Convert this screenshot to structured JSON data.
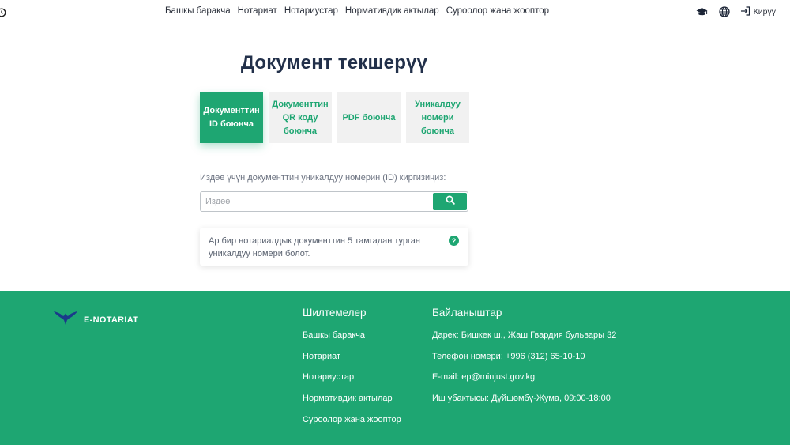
{
  "header": {
    "nav": [
      "Башкы баракча",
      "Нотариат",
      "Нотариустар",
      "Нормативдик актылар",
      "Суроолор жана жооптор"
    ],
    "login_label": "Кирүү"
  },
  "page": {
    "title": "Документ текшерүү",
    "tabs": [
      {
        "label": "Документтин ID боюнча",
        "active": true
      },
      {
        "label": "Документтин QR коду боюнча",
        "active": false
      },
      {
        "label": "PDF боюнча",
        "active": false
      },
      {
        "label": "Уникалдуу номери боюнча",
        "active": false
      }
    ],
    "search_label": "Издөө үчүн документтин уникалдуу номерин (ID) киргизиңиз:",
    "search_placeholder": "Издөө",
    "info_text": "Ар бир нотариалдык документтин 5 тамгадан турган уникалдуу номери болот.",
    "help_symbol": "?"
  },
  "footer": {
    "logo_text": "E-NOTARIAT",
    "links_title": "Шилтемелер",
    "links": [
      "Башкы баракча",
      "Нотариат",
      "Нотариустар",
      "Нормативдик актылар",
      "Суроолор жана жооптор"
    ],
    "contacts_title": "Байланыштар",
    "contacts": [
      "Дарек: Бишкек ш., Жаш Гвардия бульвары 32",
      "Телефон номери: +996 (312) 65-10-10",
      "E-mail: ep@minjust.gov.kg",
      "Иш убактысы: Дүйшөмбү-Жума, 09:00-18:00"
    ]
  },
  "colors": {
    "accent": "#1ea672",
    "title": "#22304a"
  },
  "icons": [
    "clock-icon",
    "graduation-cap-icon",
    "globe-icon",
    "login-icon",
    "search-icon",
    "help-icon",
    "eagle-logo-icon"
  ]
}
